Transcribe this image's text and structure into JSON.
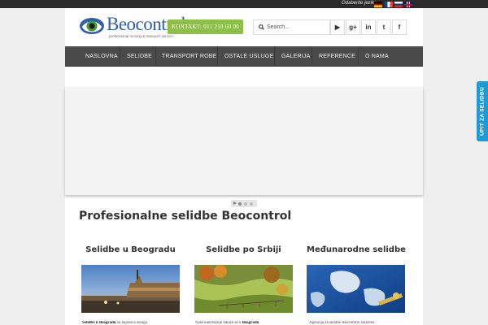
{
  "topbar": {
    "language_label": "Odaberite jezik:",
    "flags": [
      "german-flag-icon",
      "french-flag-icon",
      "russian-flag-icon",
      "english-flag-icon"
    ]
  },
  "header": {
    "logo_text": "Beocontrol",
    "logo_tagline": "professional moving & transport service",
    "contact_button": "KONTAKT: 011 210 60 00",
    "search_placeholder": "Search...",
    "social_icons": [
      "youtube-icon",
      "google-plus-icon",
      "linkedin-icon",
      "twitter-icon",
      "facebook-icon"
    ],
    "social_glyphs": {
      "youtube": "▶",
      "googleplus": "g+",
      "linkedin": "in",
      "twitter": "t",
      "facebook": "f"
    }
  },
  "nav": {
    "items": [
      "NASLOVNA",
      "SELIDBE",
      "TRANSPORT ROBE",
      "OSTALE USLUGE",
      "GALERIJA",
      "REFERENCE",
      "O NAMA"
    ]
  },
  "main": {
    "title": "Profesionalne selidbe Beocontrol",
    "columns": [
      {
        "title": "Selidbe u Beogradu",
        "image": "belgrade-fortress-photo",
        "text_bold": "Selidbe u Beogradu",
        "text": " su najčešća usluga"
      },
      {
        "title": "Selidbe po Srbiji",
        "image": "countryside-photo",
        "text_bold": "Beogradu",
        "text_pre": "Naše kancelarije nalaze se u "
      },
      {
        "title": "Međunarodne selidbe",
        "image": "world-map-photo",
        "text": "Agencija za selidbe Beocontrol zauzima"
      }
    ]
  },
  "side_tab": {
    "label": "UPIT ZA SELIDBU"
  },
  "colors": {
    "accent_green": "#8dc046",
    "nav_bg": "#4a4a4a",
    "brand_blue": "#2f5fa6",
    "tab_blue": "#1e9ad6"
  }
}
